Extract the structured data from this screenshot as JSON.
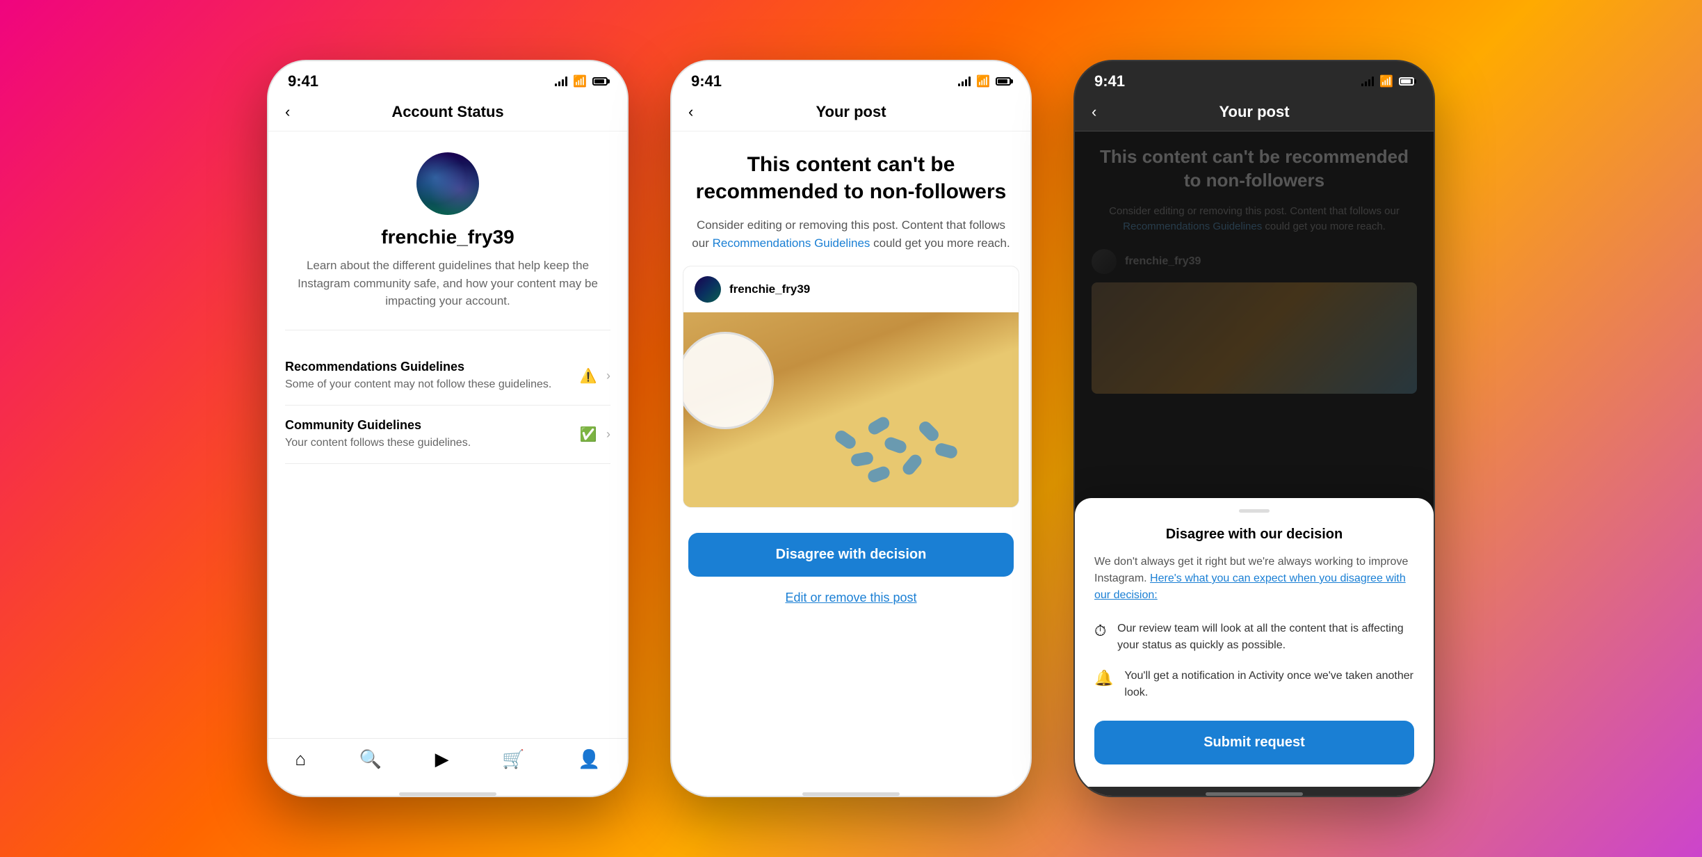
{
  "background": {
    "gradient": "linear-gradient(135deg, #f0047f 0%, #ff6600 40%, #ffaa00 60%, #cc44cc 100%)"
  },
  "phone1": {
    "status_time": "9:41",
    "nav_title": "Account Status",
    "username": "frenchie_fry39",
    "profile_desc": "Learn about the different guidelines that help keep the Instagram community safe, and how your content may be impacting your account.",
    "guidelines": [
      {
        "title": "Recommendations Guidelines",
        "subtitle": "Some of your content may not follow these guidelines.",
        "icon": "warning",
        "icon_color": "#ff9900"
      },
      {
        "title": "Community Guidelines",
        "subtitle": "Your content follows these guidelines.",
        "icon": "check",
        "icon_color": "#00aa44"
      }
    ]
  },
  "phone2": {
    "status_time": "9:41",
    "nav_title": "Your post",
    "content_title": "This content can't be recommended to non-followers",
    "content_desc": "Consider editing or removing this post. Content that follows our",
    "rec_guidelines_link": "Recommendations Guidelines",
    "content_desc2": "could get you more reach.",
    "post_username": "frenchie_fry39",
    "disagree_btn": "Disagree with decision",
    "edit_remove_link": "Edit or remove this post"
  },
  "phone3": {
    "status_time": "9:41",
    "nav_title": "Your post",
    "content_title": "This content can't be recommended to non-followers",
    "content_desc": "Consider editing or removing this post. Content that follows our",
    "rec_guidelines_link": "Recommendations Guidelines",
    "content_desc2": "could get you more reach.",
    "post_username": "frenchie_fry39",
    "sheet": {
      "title": "Disagree with our decision",
      "desc_before_link": "We don't always get it right but we're always working to improve Instagram. ",
      "link_text": "Here's what you can expect when you disagree with our decision:",
      "items": [
        {
          "icon": "⏱",
          "text": "Our review team will look at all the content that is affecting your status as quickly as possible."
        },
        {
          "icon": "🔔",
          "text": "You'll get a notification in Activity once we've taken another look."
        }
      ],
      "submit_btn": "Submit request"
    }
  }
}
